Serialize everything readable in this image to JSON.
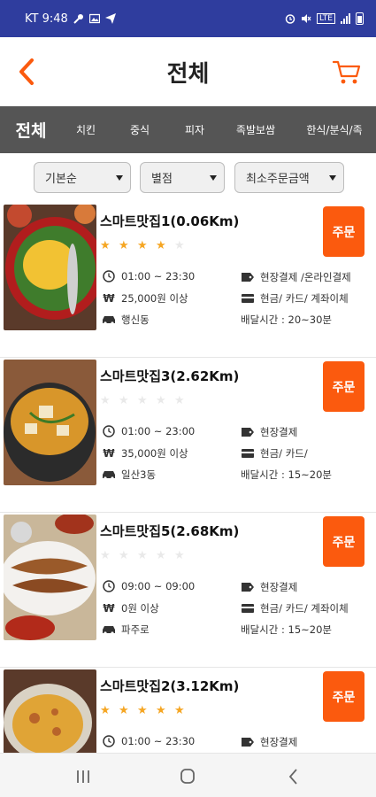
{
  "status_bar": {
    "carrier_time": "KT 9:48",
    "lte": "LTE"
  },
  "header": {
    "title": "전체"
  },
  "tabs": [
    "전체",
    "치킨",
    "중식",
    "피자",
    "족발보쌈",
    "한식/분식/족"
  ],
  "filters": {
    "sort": "기본순",
    "rating": "별점",
    "min_order": "최소주문금액"
  },
  "order_label": "주문",
  "restaurants": [
    {
      "name": "스마트맛집1(0.06Km)",
      "rating": 4,
      "hours": "01:00 ~ 23:30",
      "min_order": "25,000원 이상",
      "area": "행신동",
      "pay_site": "현장결제 /온라인결제",
      "pay_methods": "현금/ 카드/ 계좌이체",
      "delivery_time": "배달시간 : 20~30분"
    },
    {
      "name": "스마트맛집3(2.62Km)",
      "rating": 0,
      "hours": "01:00 ~ 23:00",
      "min_order": "35,000원 이상",
      "area": "일산3동",
      "pay_site": "현장결제",
      "pay_methods": "현금/ 카드/",
      "delivery_time": "배달시간 : 15~20분"
    },
    {
      "name": "스마트맛집5(2.68Km)",
      "rating": 0,
      "hours": "09:00 ~ 09:00",
      "min_order": "0원 이상",
      "area": "파주로",
      "pay_site": "현장결제",
      "pay_methods": "현금/ 카드/ 계좌이체",
      "delivery_time": "배달시간 : 15~20분"
    },
    {
      "name": "스마트맛집2(3.12Km)",
      "rating": 5,
      "hours": "01:00 ~ 23:30",
      "min_order": "",
      "area": "",
      "pay_site": "현장결제",
      "pay_methods": "",
      "delivery_time": ""
    }
  ],
  "colors": {
    "accent": "#fb5a0e",
    "status_bar": "#2f3d9e",
    "tab_bar": "#555555",
    "star": "#f5a623",
    "star_off": "#e9e9e9"
  }
}
